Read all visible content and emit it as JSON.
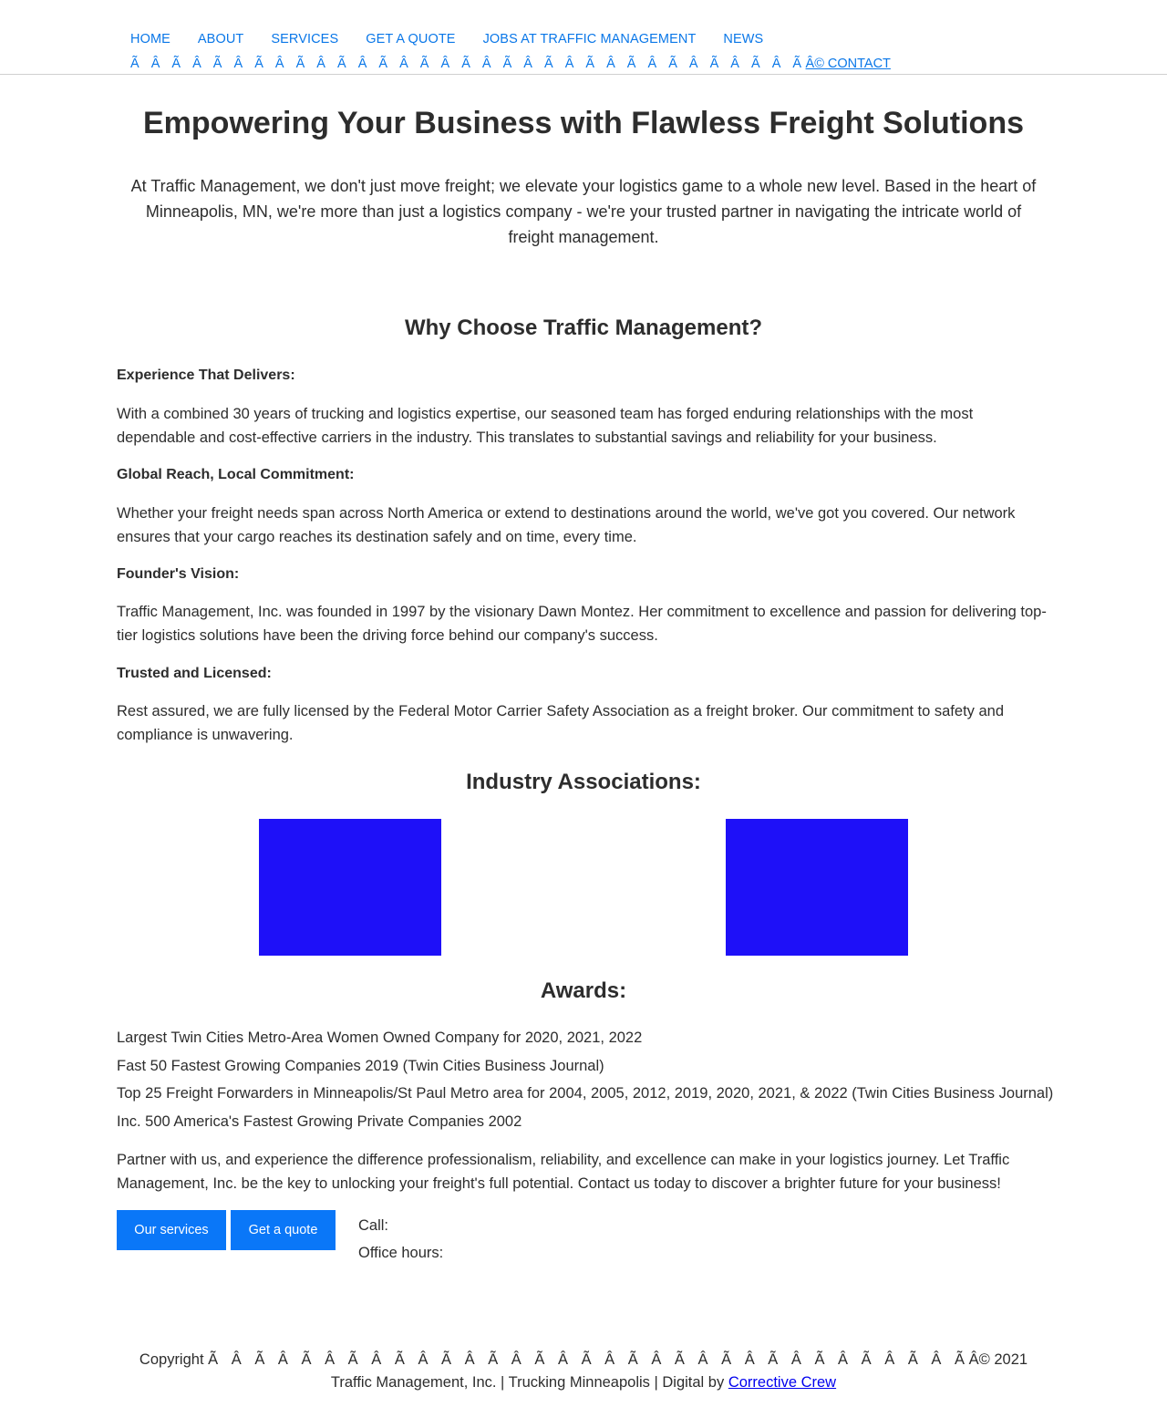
{
  "nav": {
    "items": [
      "HOME",
      "ABOUT",
      "SERVICES",
      "GET A QUOTE",
      "JOBS AT TRAFFIC MANAGEMENT",
      "NEWS"
    ],
    "garbled_prefix": "Ã Â Ã Â Ã Â Ã Â Ã Â Ã Â Ã Â Ã Â Ã Â Ã Â Ã Â Ã Â Ã Â Ã Â Ã Â Ã Â Ã",
    "contact": "Â© CONTACT"
  },
  "hero": {
    "title": "Empowering Your Business with Flawless Freight Solutions",
    "intro": "At Traffic Management, we don't just move freight; we elevate your logistics game to a whole new level. Based in the heart of Minneapolis, MN, we're more than just a logistics company - we're your trusted partner in navigating the intricate world of freight management."
  },
  "why": {
    "title": "Why Choose Traffic Management?",
    "features": [
      {
        "label": "Experience That Delivers:",
        "text": "With a combined 30 years of trucking and logistics expertise, our seasoned team has forged enduring relationships with the most dependable and cost-effective carriers in the industry. This translates to substantial savings and reliability for your business."
      },
      {
        "label": "Global Reach, Local Commitment:",
        "text": "Whether your freight needs span across North America or extend to destinations around the world, we've got you covered. Our network ensures that your cargo reaches its destination safely and on time, every time."
      },
      {
        "label": "Founder's Vision:",
        "text": "Traffic Management, Inc. was founded in 1997 by the visionary Dawn Montez. Her commitment to excellence and passion for delivering top-tier logistics solutions have been the driving force behind our company's success."
      },
      {
        "label": "Trusted and Licensed:",
        "text": "Rest assured, we are fully licensed by the Federal Motor Carrier Safety Association as a freight broker. Our commitment to safety and compliance is unwavering."
      }
    ]
  },
  "associations": {
    "title": "Industry Associations:",
    "logo_color": "#1e10f8"
  },
  "awards": {
    "title": "Awards:",
    "items": [
      "Largest Twin Cities Metro-Area Women Owned Company for 2020, 2021, 2022",
      "Fast 50 Fastest Growing Companies 2019 (Twin Cities Business Journal)",
      "Top 25 Freight Forwarders in Minneapolis/St Paul Metro area for 2004, 2005, 2012, 2019, 2020, 2021, & 2022 (Twin Cities Business Journal)",
      "Inc. 500 America's Fastest Growing Private Companies 2002"
    ]
  },
  "closing": "Partner with us, and experience the difference professionalism, reliability, and excellence can make in your logistics journey. Let Traffic Management, Inc. be the key to unlocking your freight's full potential. Contact us today to discover a brighter future for your business!",
  "cta": {
    "services_label": "Our services",
    "quote_label": "Get a quote"
  },
  "contact": {
    "call_label": "Call:",
    "hours_label": "Office hours:"
  },
  "footer": {
    "copyright_prefix": "Copyright",
    "garbled": "Ã Â Ã Â Ã Â Ã Â Ã Â Ã Â Ã Â Ã Â Ã Â Ã Â Ã Â Ã Â Ã Â Ã Â Ã Â Ã Â Ã",
    "copyright_suffix": "Â© 2021",
    "line2_text": "Traffic Management, Inc. | Trucking Minneapolis | Digital by ",
    "credit_link": "Corrective Crew"
  },
  "colors": {
    "accent": "#0a77e8",
    "button": "#0a77f8",
    "text": "#2d2d2d",
    "logo_placeholder": "#1e10f8"
  }
}
